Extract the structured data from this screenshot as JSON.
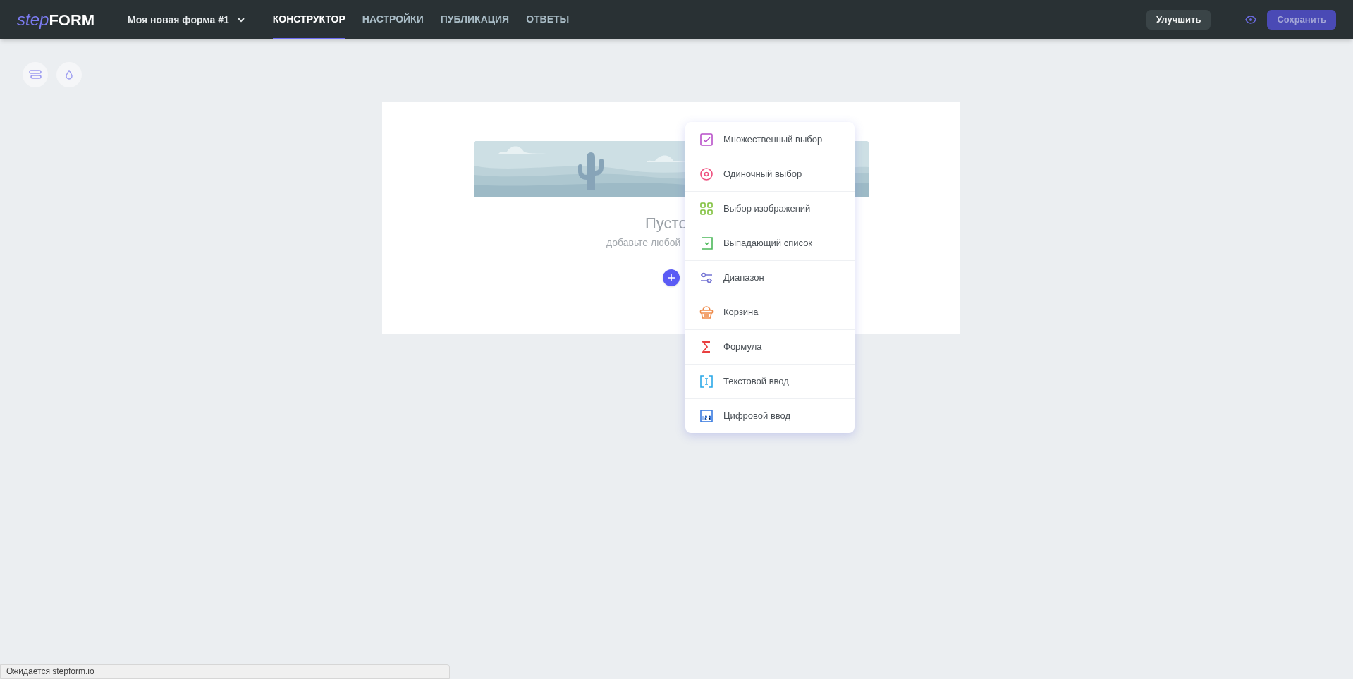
{
  "header": {
    "logo": {
      "part_1": "step",
      "part_2": "FORM"
    },
    "form_title": "Моя новая форма #1",
    "tabs": [
      {
        "label": "КОНСТРУКТОР",
        "selected": true
      },
      {
        "label": "НАСТРОЙКИ",
        "selected": false
      },
      {
        "label": "ПУБЛИКАЦИЯ",
        "selected": false
      },
      {
        "label": "ОТВЕТЫ",
        "selected": false
      }
    ],
    "upgrade_button": "Улучшить",
    "save_button": {
      "label": "Сохранить",
      "disabled": true
    }
  },
  "empty_form": {
    "title": "Пусто",
    "hint": "добавьте любой"
  },
  "field_menu": [
    {
      "kind": "checkbox",
      "label": "Множественный выбор"
    },
    {
      "kind": "radio",
      "label": "Одиночный выбор"
    },
    {
      "kind": "images",
      "label": "Выбор изображений"
    },
    {
      "kind": "dropdown",
      "label": "Выпадающий список"
    },
    {
      "kind": "range",
      "label": "Диапазон"
    },
    {
      "kind": "cart",
      "label": "Корзина"
    },
    {
      "kind": "formula",
      "label": "Формула"
    },
    {
      "kind": "text",
      "label": "Текстовой ввод"
    },
    {
      "kind": "number",
      "label": "Цифровой ввод"
    }
  ],
  "status_bar": "Ожидается stepform.io"
}
